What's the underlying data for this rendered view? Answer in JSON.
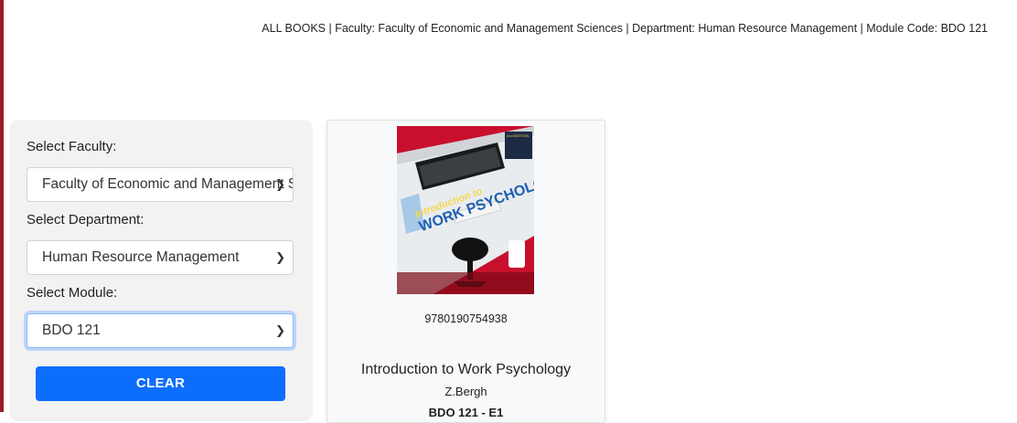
{
  "breadcrumb": "ALL BOOKS | Faculty: Faculty of Economic and Management Sciences | Department: Human Resource Management | Module Code: BDO 121",
  "filters": {
    "faculty_label": "Select Faculty:",
    "faculty_value": "Faculty of Economic and Management Sciences",
    "department_label": "Select Department:",
    "department_value": "Human Resource Management",
    "module_label": "Select Module:",
    "module_value": "BDO 121",
    "clear_label": "CLEAR"
  },
  "book": {
    "cover_title_line1": "Introduction to",
    "cover_title_line2": "WORK PSYCHOLOGY",
    "cover_edition": "2nd EDITION",
    "isbn": "9780190754938",
    "title": "Introduction to Work Psychology",
    "author": "Z.Bergh",
    "code": "BDO 121 - E1"
  },
  "colors": {
    "accent_red": "#9b1b2a",
    "button_blue": "#0d6efd",
    "cover_red": "#c8102e"
  }
}
